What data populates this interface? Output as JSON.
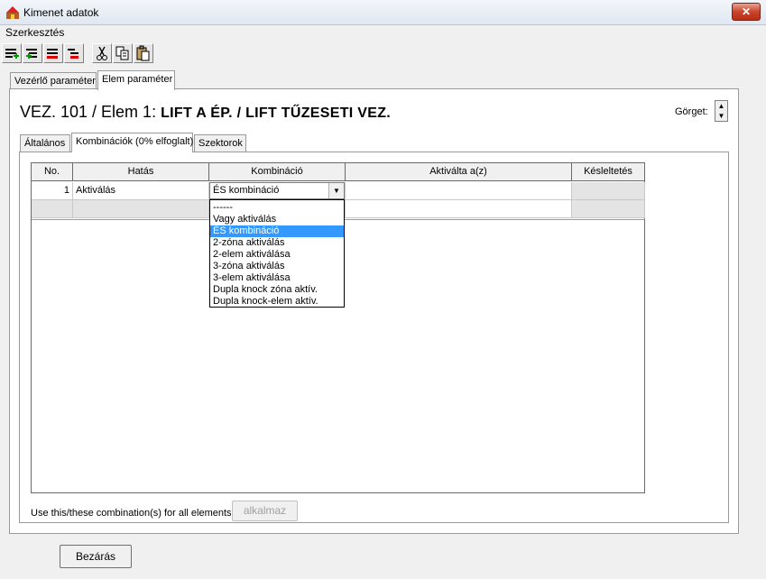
{
  "window": {
    "title": "Kimenet adatok",
    "close_glyph": "✕"
  },
  "menu": {
    "items": [
      "Szerkesztés"
    ]
  },
  "toolbar": {
    "buttons": [
      {
        "icon": "insert-row-green-icon"
      },
      {
        "icon": "add-row-green-icon"
      },
      {
        "icon": "delete-row-red-icon"
      },
      {
        "icon": "remove-row-red-icon"
      },
      {
        "icon": "cut-icon"
      },
      {
        "icon": "copy-icon"
      },
      {
        "icon": "paste-icon"
      }
    ]
  },
  "outer_tabs": [
    {
      "label": "Vezérlő paraméter",
      "active": false
    },
    {
      "label": "Elem paraméter",
      "active": true
    }
  ],
  "header": {
    "prefix": "VEZ. 101 / Elem 1:",
    "name": "LIFT A ÉP. / LIFT TŰZESETI VEZ.",
    "scroll_label": "Görget:"
  },
  "inner_tabs": [
    {
      "label": "Általános",
      "active": false
    },
    {
      "label": "Kombinációk (0% elfoglalt)",
      "active": true
    },
    {
      "label": "Szektorok",
      "active": false
    }
  ],
  "grid": {
    "columns": [
      "No.",
      "Hatás",
      "Kombináció",
      "Aktiválta a(z)",
      "Késleltetés"
    ],
    "rows": [
      {
        "no": "1",
        "hatas": "Aktiválás",
        "kombinacio": "ÉS kombináció",
        "aktivalta": "",
        "kesleltetes": ""
      }
    ]
  },
  "dropdown": {
    "options": [
      "------",
      "Vagy aktiválás",
      "ÉS kombináció",
      "2-zóna aktiválás",
      "2-elem aktiválása",
      "3-zóna aktiválás",
      "3-elem aktiválása",
      "Dupla knock zóna aktív.",
      "Dupla knock-elem aktív."
    ],
    "selected_index": 2
  },
  "footer": {
    "apply_text": "Use this/these combination(s) for all elements",
    "apply_button": "alkalmaz",
    "close_button": "Bezárás"
  }
}
